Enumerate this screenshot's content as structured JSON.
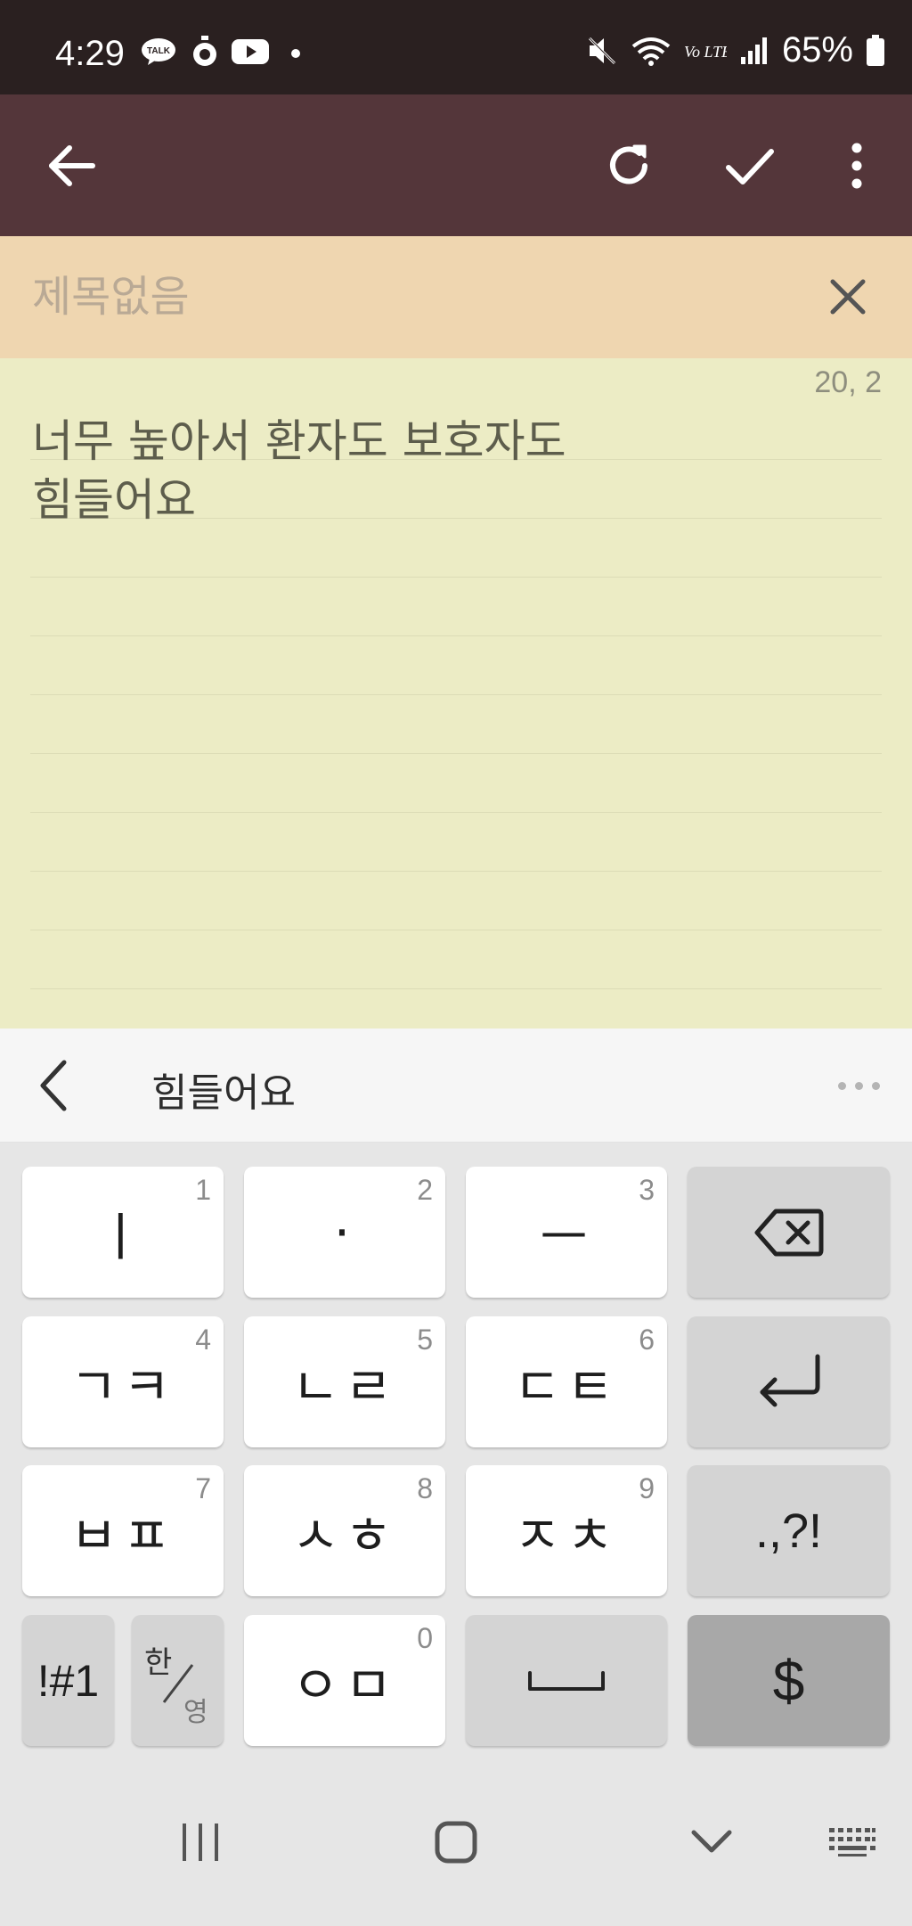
{
  "status_bar": {
    "time": "4:29",
    "battery": "65%",
    "talk_badge": "TALK",
    "volte": "Vo LTE"
  },
  "title": {
    "placeholder": "제목없음",
    "value": ""
  },
  "note": {
    "cursor_position": "20, 2",
    "text": "너무 높아서 환자도 보호자도\n힘들어요"
  },
  "suggestion": {
    "word": "힘들어요"
  },
  "keyboard": {
    "rows": [
      [
        {
          "label": "ㅣ",
          "num": "1"
        },
        {
          "label": "·",
          "num": "2"
        },
        {
          "label": "ㅡ",
          "num": "3"
        }
      ],
      [
        {
          "label": "ㄱㅋ",
          "num": "4"
        },
        {
          "label": "ㄴㄹ",
          "num": "5"
        },
        {
          "label": "ㄷㅌ",
          "num": "6"
        }
      ],
      [
        {
          "label": "ㅂㅍ",
          "num": "7"
        },
        {
          "label": "ㅅㅎ",
          "num": "8"
        },
        {
          "label": "ㅈㅊ",
          "num": "9"
        }
      ]
    ],
    "punct_label": ".,?!",
    "symbols_label": "!#1",
    "lang_top": "한",
    "lang_bottom": "영",
    "zero_key": {
      "label": "ㅇㅁ",
      "num": "0"
    },
    "currency_label": "$"
  },
  "colors": {
    "status_bar": "#2a2020",
    "app_bar": "#54363a",
    "title_bg": "#efd6b0",
    "note_bg": "#ececc5"
  }
}
